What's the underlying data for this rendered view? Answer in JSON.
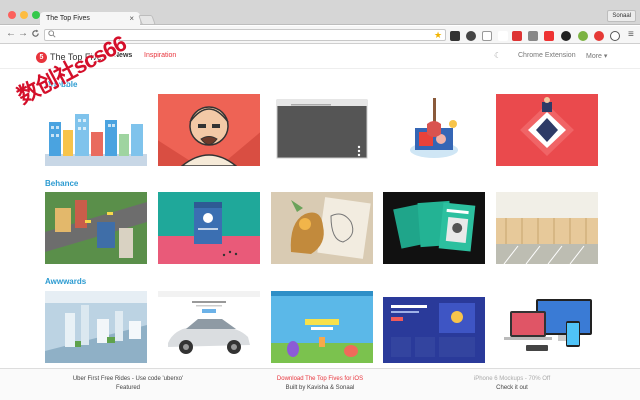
{
  "browser": {
    "tab_title": "The Top Fives",
    "tab_close": "×",
    "profile_name": "Sonaal",
    "back_icon": "←",
    "forward_icon": "→",
    "reload_icon": "C",
    "search_icon": "Q",
    "star_icon": "★",
    "menu_icon": "≡"
  },
  "header": {
    "logo_letter": "5",
    "brand": "The Top Fives",
    "nav_news": "News",
    "nav_inspiration": "Inspiration",
    "moon_icon": "☾",
    "chrome_extension": "Chrome Extension",
    "more": "More ▾"
  },
  "watermark": "数创社scs66",
  "sections": [
    {
      "title": "Dribbble"
    },
    {
      "title": "Behance"
    },
    {
      "title": "Awwwards"
    }
  ],
  "footer": {
    "left_title": "Uber First Free Rides - Use code 'uberxo'",
    "left_sub": "Featured",
    "mid_title": "Download The Top Fives for iOS",
    "mid_sub": "Built by Kavisha & Sonaal",
    "right_title": "iPhone 6 Mockups - 70% Off",
    "right_sub": "Check it out"
  },
  "colors": {
    "accent_red": "#e8343c",
    "section_blue": "#2c9bd1"
  }
}
